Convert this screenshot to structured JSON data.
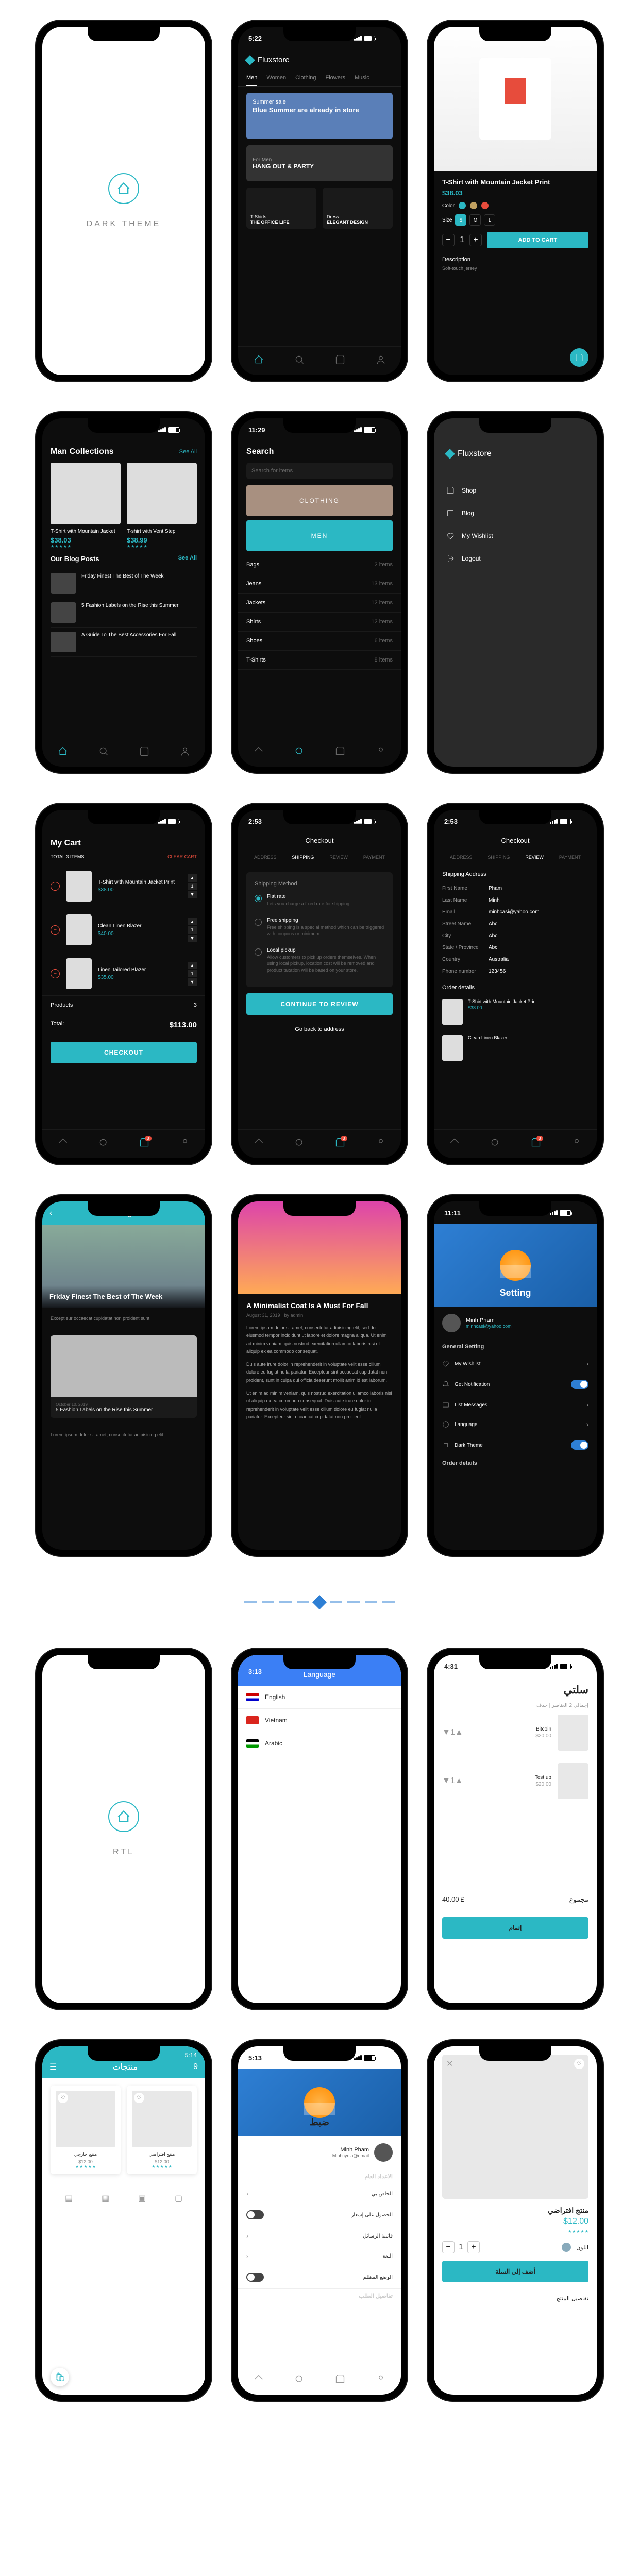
{
  "sections": {
    "dark_theme": "DARK THEME",
    "rtl": "RTL"
  },
  "brand": "Fluxstore",
  "times": {
    "t1": "5:22",
    "t2": "11:29",
    "t3": "2:53",
    "t4": "11:11",
    "t5": "3:13",
    "t6": "4:31",
    "t7": "5:14",
    "t8": "5:13",
    "t9": "9"
  },
  "home": {
    "tabs": [
      "Men",
      "Women",
      "Clothing",
      "Flowers",
      "Music"
    ],
    "banner1_sub": "Summer sale",
    "banner1_title": "Blue Summer are already in store",
    "banner2_sub": "For Men",
    "banner2_title": "HANG OUT & PARTY",
    "card1_sub": "T-Shirts",
    "card1_title": "THE OFFICE LIFE",
    "card2_sub": "Dress",
    "card2_title": "ELEGANT DESIGN"
  },
  "product": {
    "name": "T-Shirt with Mountain Jacket Print",
    "price": "$38.03",
    "color_label": "Color",
    "size_label": "Size",
    "sizes": [
      "S",
      "M",
      "L"
    ],
    "qty": "1",
    "add": "ADD TO CART",
    "desc_h": "Description",
    "desc_t": "Soft-touch jersey"
  },
  "collections": {
    "title": "Man Collections",
    "see": "See All",
    "p1": "T-Shirt with Mountain Jacket",
    "p1p": "$38.03",
    "p2": "T-shirt with Vent Step",
    "p2p": "$38.99",
    "blog_h": "Our Blog Posts",
    "b1": "Friday Finest The Best of The Week",
    "b2": "5 Fashion Labels on the Rise this Summer",
    "b3": "A Guide To The Best Accessories For Fall"
  },
  "search": {
    "title": "Search",
    "ph": "Search for items",
    "cat1": "CLOTHING",
    "cat2": "MEN",
    "rows": [
      {
        "n": "Bags",
        "c": "2 items"
      },
      {
        "n": "Jeans",
        "c": "13 items"
      },
      {
        "n": "Jackets",
        "c": "12 items"
      },
      {
        "n": "Shirts",
        "c": "12 items"
      },
      {
        "n": "Shoes",
        "c": "6 items"
      },
      {
        "n": "T-Shirts",
        "c": "8 items"
      }
    ]
  },
  "drawer": {
    "items": [
      "Shop",
      "Blog",
      "My Wishlist",
      "Logout"
    ]
  },
  "cart": {
    "title": "My Cart",
    "total_lbl": "TOTAL",
    "items_lbl": "3 ITEMS",
    "clear": "CLEAR CART",
    "i1": "T-Shirt with Mountain Jacket Print",
    "i1p": "$38.00",
    "i2": "Clean Linen Blazer",
    "i2p": "$40.00",
    "i3": "Linen Tailored Blazer",
    "i3p": "$35.00",
    "products": "Products",
    "count": "3",
    "total": "Total:",
    "amount": "$113.00",
    "checkout": "CHECKOUT"
  },
  "checkout": {
    "title": "Checkout",
    "steps": [
      "ADDRESS",
      "SHIPPING",
      "REVIEW",
      "PAYMENT"
    ],
    "ship_h": "Shipping Method",
    "flat": "Flat rate",
    "flat_d": "Lets you charge a fixed rate for shipping.",
    "free": "Free shipping",
    "free_d": "Free shipping is a special method which can be triggered with coupons or minimum.",
    "local": "Local pickup",
    "local_d": "Allow customers to pick up orders themselves. When using local pickup, location cost will be removed and product taxation will be based on your store.",
    "continue": "CONTINUE TO REVIEW",
    "back": "Go back to address",
    "addr_h": "Shipping Address",
    "addr": [
      {
        "k": "First Name",
        "v": "Pham"
      },
      {
        "k": "Last Name",
        "v": "Minh"
      },
      {
        "k": "Email",
        "v": "minhcasi@yahoo.com"
      },
      {
        "k": "Street Name",
        "v": "Abc"
      },
      {
        "k": "City",
        "v": "Abc"
      },
      {
        "k": "State / Province",
        "v": "Abc"
      },
      {
        "k": "Country",
        "v": "Australia"
      },
      {
        "k": "Phone number",
        "v": "123456"
      }
    ],
    "order_h": "Order details",
    "o1": "T-Shirt with Mountain Jacket Print",
    "o1p": "$38.00",
    "o2": "Clean Linen Blazer"
  },
  "blog": {
    "title": "Blog",
    "h1": "Friday Finest The Best of The Week",
    "t1": "Exceptieur occaecat cupidatat non proident sunt",
    "h2": "5 Fashion Labels on the Rise this Summer",
    "date": "October 10, 2019",
    "t2": "Lorem ipsum dolor sit amet, consectetur adipisicing elit"
  },
  "article": {
    "title": "A Minimalist Coat Is A Must For Fall",
    "meta": "August 31, 2019 · by admin",
    "p1": "Lorem ipsum dolor sit amet, consectetur adipisicing elit, sed do eiusmod tempor incididunt ut labore et dolore magna aliqua. Ut enim ad minim veniam, quis nostrud exercitation ullamco laboris nisi ut aliquip ex ea commodo consequat.",
    "p2": "Duis aute irure dolor in reprehenderit in voluptate velit esse cillum dolore eu fugiat nulla pariatur. Excepteur sint occaecat cupidatat non proident, sunt in culpa qui officia deserunt mollit anim id est laborum.",
    "p3": "Ut enim ad minim veniam, quis nostrud exercitation ullamco laboris nisi ut aliquip ex ea commodo consequat. Duis aute irure dolor in reprehenderit in voluptate velit esse cillum dolore eu fugiat nulla pariatur. Excepteur sint occaecat cupidatat non proident."
  },
  "settings": {
    "title": "Setting",
    "name": "Minh Pham",
    "email": "minhcasi@yahoo.com",
    "general": "General Setting",
    "wishlist": "My Wishlist",
    "notif": "Get Notification",
    "msgs": "List Messages",
    "lang": "Language",
    "dark": "Dark Theme",
    "order": "Order details"
  },
  "language": {
    "title": "Language",
    "en": "English",
    "vi": "Vietnam",
    "ar": "Arabic"
  },
  "rtl_cart": {
    "title": "سلتي",
    "sub": "إجمالي 2 العناصر | حذف",
    "i1": "Bitcoin",
    "i1p": "$20.00",
    "i2": "Test up",
    "i2p": "$20.00",
    "total": "مجموع",
    "amt": "£ 40.00",
    "btn": "إتمام"
  },
  "rtl_products": {
    "title": "منتجات",
    "p1": "منتج افتراضي",
    "p1p": "$12.00",
    "p2": "منتج خارجي",
    "p2p": "$12.00"
  },
  "rtl_settings": {
    "title": "ضبط",
    "name": "Minh Pham",
    "email": "Minhcyola@email",
    "general": "الاعداد العام",
    "items": [
      "الخاص بي",
      "الحصول على إشعار",
      "قائمة الرسائل",
      "اللغة",
      "الوضع المظلم"
    ],
    "order": "تفاصيل الطلب"
  },
  "rtl_product": {
    "name": "منتج افتراضي",
    "price": "$12.00",
    "color": "اللون",
    "qty": "1",
    "add": "أضف إلى السلة",
    "desc": "تفاصيل المنتج"
  }
}
